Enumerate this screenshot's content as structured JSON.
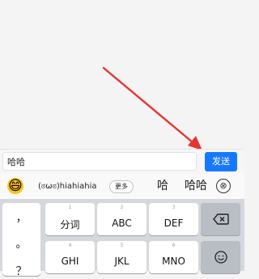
{
  "input_bar": {
    "message_text": "哈哈",
    "send_label": "发送"
  },
  "candidates": {
    "emoji": "😄",
    "kaomoji": "(ಠωಠ)hiahiahia",
    "more_label": "更多",
    "word1": "哈",
    "word2": "哈哈",
    "close_glyph": "⊗"
  },
  "keyboard": {
    "punct_keys": [
      "，",
      "。",
      "？"
    ],
    "row1": [
      {
        "num": "1",
        "label": "分词"
      },
      {
        "num": "2",
        "label": "ABC"
      },
      {
        "num": "3",
        "label": "DEF"
      }
    ],
    "row2": [
      {
        "num": "4",
        "label": "GHI"
      },
      {
        "num": "5",
        "label": "JKL"
      },
      {
        "num": "6",
        "label": "MNO"
      }
    ],
    "delete_icon": "backspace-icon",
    "emoji_icon": "smiley-icon"
  },
  "colors": {
    "send_button": "#1678ff",
    "arrow": "#e8322f",
    "keyboard_bg": "#d4d7dc"
  }
}
